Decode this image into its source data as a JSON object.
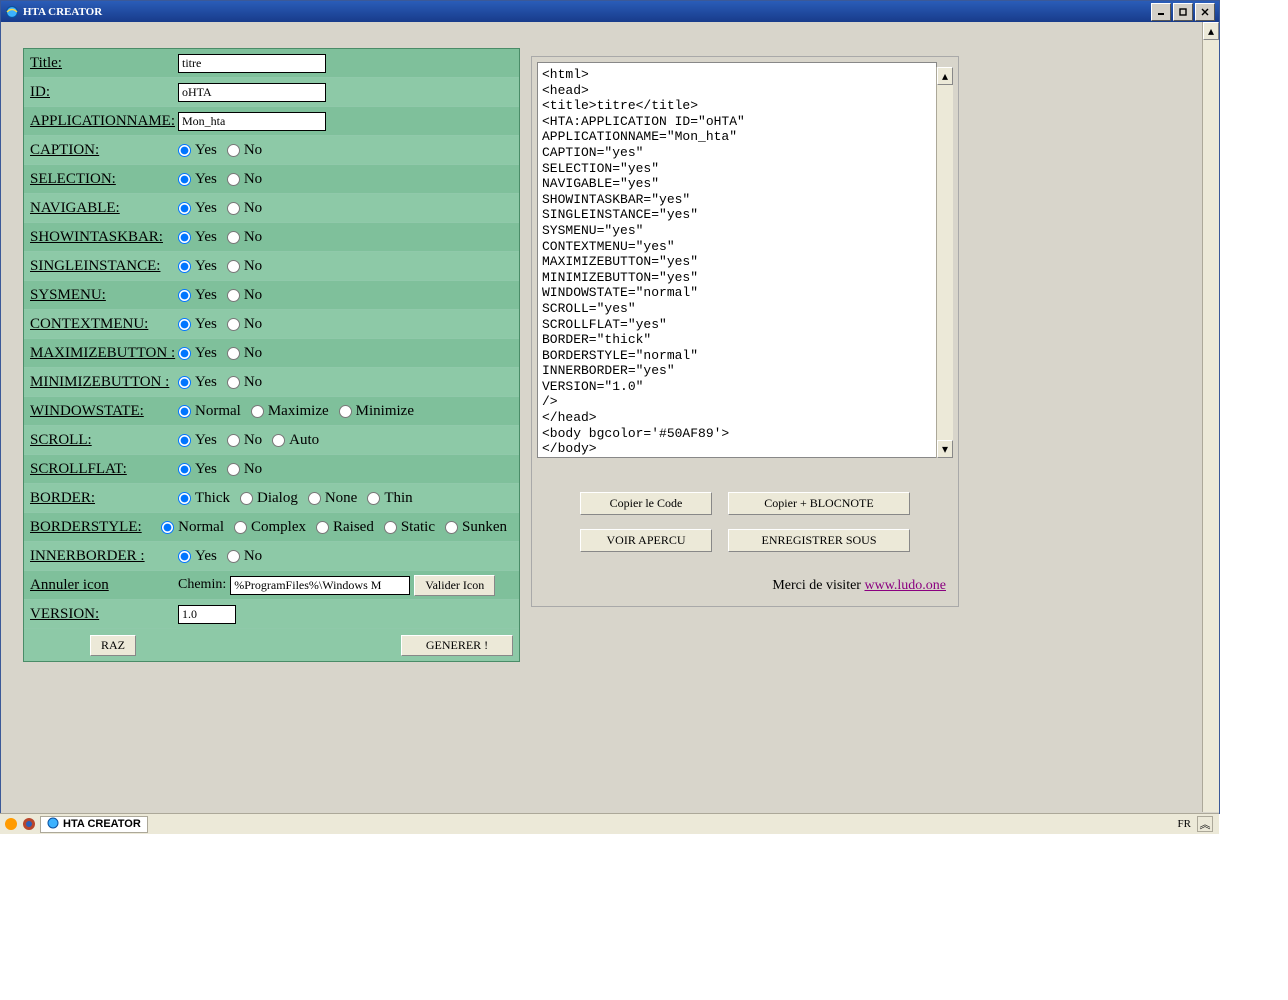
{
  "window": {
    "title": "HTA CREATOR"
  },
  "form": {
    "title_label": "Title:",
    "title_value": "titre",
    "id_label": "ID:",
    "id_value": "oHTA",
    "appname_label": "APPLICATIONNAME:",
    "appname_value": "Mon_hta",
    "caption_label": "CAPTION:",
    "selection_label": "SELECTION:",
    "navigable_label": "NAVIGABLE:",
    "showintaskbar_label": "SHOWINTASKBAR:",
    "singleinstance_label": "SINGLEINSTANCE:",
    "sysmenu_label": "SYSMENU:",
    "contextmenu_label": "CONTEXTMENU:",
    "maximizebutton_label": "MAXIMIZEBUTTON :",
    "minimizebutton_label": "MINIMIZEBUTTON :",
    "windowstate_label": "WINDOWSTATE:",
    "scroll_label": "SCROLL:",
    "scrollflat_label": "SCROLLFLAT:",
    "border_label": "BORDER:",
    "borderstyle_label": "BORDERSTYLE:",
    "innerborder_label": "INNERBORDER :",
    "annuler_label": "Annuler icon",
    "chemin_label": "Chemin:",
    "chemin_value": "%ProgramFiles%\\Windows M",
    "valider_icon": "Valider Icon",
    "version_label": "VERSION:",
    "version_value": "1.0",
    "raz": "RAZ",
    "generer": "GENERER !"
  },
  "opts": {
    "yes": "Yes",
    "no": "No",
    "normal": "Normal",
    "maximize": "Maximize",
    "minimize": "Minimize",
    "auto": "Auto",
    "thick": "Thick",
    "dialog": "Dialog",
    "none": "None",
    "thin": "Thin",
    "complex": "Complex",
    "raised": "Raised",
    "static": "Static",
    "sunken": "Sunken"
  },
  "code": "<html>\n<head>\n<title>titre</title>\n<HTA:APPLICATION ID=\"oHTA\"\nAPPLICATIONNAME=\"Mon_hta\"\nCAPTION=\"yes\"\nSELECTION=\"yes\"\nNAVIGABLE=\"yes\"\nSHOWINTASKBAR=\"yes\"\nSINGLEINSTANCE=\"yes\"\nSYSMENU=\"yes\"\nCONTEXTMENU=\"yes\"\nMAXIMIZEBUTTON=\"yes\"\nMINIMIZEBUTTON=\"yes\"\nWINDOWSTATE=\"normal\"\nSCROLL=\"yes\"\nSCROLLFLAT=\"yes\"\nBORDER=\"thick\"\nBORDERSTYLE=\"normal\"\nINNERBORDER=\"yes\"\nVERSION=\"1.0\"\n/>\n</head>\n<body bgcolor='#50AF89'>\n</body>",
  "buttons": {
    "copy_code": "Copier le Code",
    "copy_blocnote": "Copier + BLOCNOTE",
    "voir_apercu": "VOIR APERCU",
    "enregistrer": "ENREGISTRER SOUS"
  },
  "footer": {
    "text": "Merci de visiter ",
    "link": "www.ludo.one"
  },
  "taskbar": {
    "app": "HTA CREATOR",
    "lang": "FR"
  }
}
